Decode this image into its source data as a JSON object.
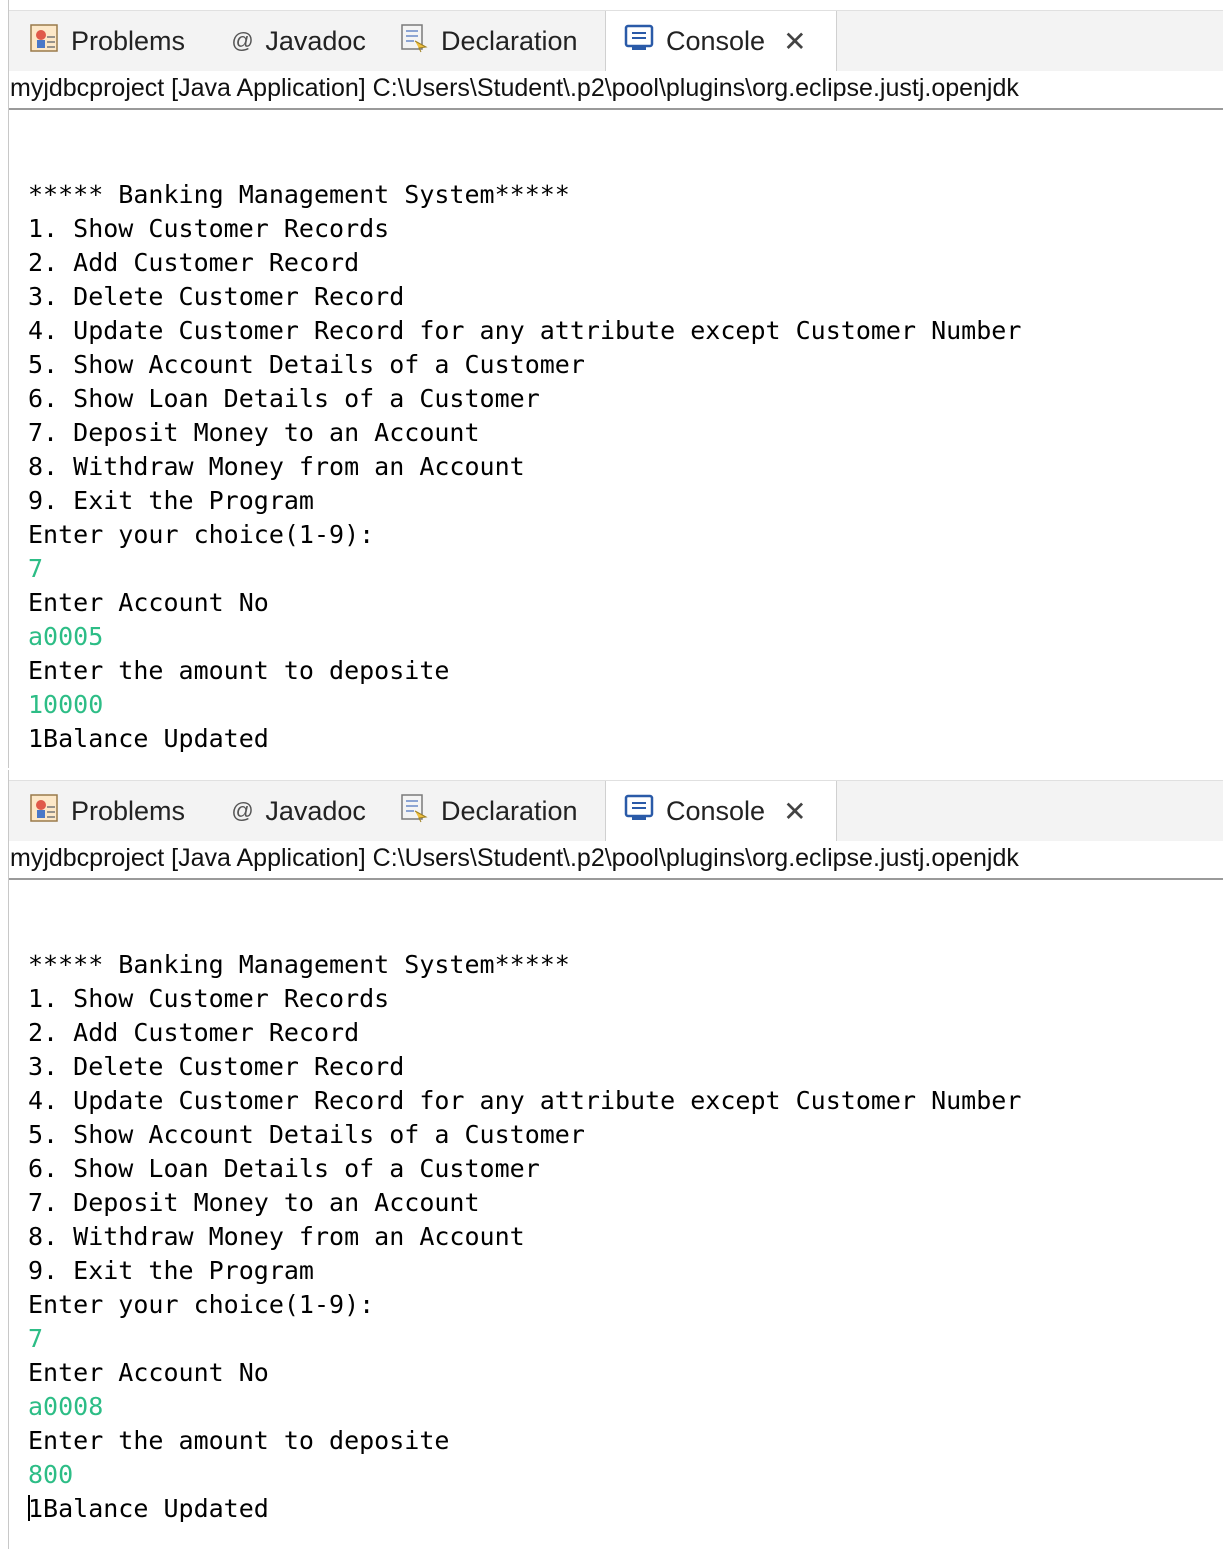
{
  "colors": {
    "input_text": "#2dbd86",
    "output_text": "#000000",
    "tabbar_bg": "#f3f3f3"
  },
  "panels": [
    {
      "tabs": [
        {
          "label": "Problems",
          "icon": "problems-icon"
        },
        {
          "label": "Javadoc",
          "icon": "at-sign-icon"
        },
        {
          "label": "Declaration",
          "icon": "declaration-icon"
        },
        {
          "label": "Console",
          "icon": "console-icon",
          "active": true
        }
      ],
      "close_glyph": "✕",
      "subtitle": "myjdbcproject [Java Application] C:\\Users\\Student\\.p2\\pool\\plugins\\org.eclipse.justj.openjdk",
      "lines": [
        {
          "text": "***** Banking Management System*****",
          "kind": "output"
        },
        {
          "text": "1. Show Customer Records",
          "kind": "output"
        },
        {
          "text": "2. Add Customer Record",
          "kind": "output"
        },
        {
          "text": "3. Delete Customer Record",
          "kind": "output"
        },
        {
          "text": "4. Update Customer Record for any attribute except Customer Number",
          "kind": "output"
        },
        {
          "text": "5. Show Account Details of a Customer",
          "kind": "output"
        },
        {
          "text": "6. Show Loan Details of a Customer",
          "kind": "output"
        },
        {
          "text": "7. Deposit Money to an Account",
          "kind": "output"
        },
        {
          "text": "8. Withdraw Money from an Account",
          "kind": "output"
        },
        {
          "text": "9. Exit the Program",
          "kind": "output"
        },
        {
          "text": "Enter your choice(1-9):",
          "kind": "output"
        },
        {
          "text": "7",
          "kind": "input"
        },
        {
          "text": "Enter Account No",
          "kind": "output"
        },
        {
          "text": "a0005",
          "kind": "input"
        },
        {
          "text": "Enter the amount to deposite",
          "kind": "output"
        },
        {
          "text": "10000",
          "kind": "input"
        },
        {
          "text": "1Balance Updated",
          "kind": "output"
        }
      ]
    },
    {
      "tabs": [
        {
          "label": "Problems",
          "icon": "problems-icon"
        },
        {
          "label": "Javadoc",
          "icon": "at-sign-icon"
        },
        {
          "label": "Declaration",
          "icon": "declaration-icon"
        },
        {
          "label": "Console",
          "icon": "console-icon",
          "active": true
        }
      ],
      "close_glyph": "✕",
      "subtitle": "myjdbcproject [Java Application] C:\\Users\\Student\\.p2\\pool\\plugins\\org.eclipse.justj.openjdk",
      "lines": [
        {
          "text": "***** Banking Management System*****",
          "kind": "output"
        },
        {
          "text": "1. Show Customer Records",
          "kind": "output"
        },
        {
          "text": "2. Add Customer Record",
          "kind": "output"
        },
        {
          "text": "3. Delete Customer Record",
          "kind": "output"
        },
        {
          "text": "4. Update Customer Record for any attribute except Customer Number",
          "kind": "output"
        },
        {
          "text": "5. Show Account Details of a Customer",
          "kind": "output"
        },
        {
          "text": "6. Show Loan Details of a Customer",
          "kind": "output"
        },
        {
          "text": "7. Deposit Money to an Account",
          "kind": "output"
        },
        {
          "text": "8. Withdraw Money from an Account",
          "kind": "output"
        },
        {
          "text": "9. Exit the Program",
          "kind": "output"
        },
        {
          "text": "Enter your choice(1-9):",
          "kind": "output"
        },
        {
          "text": "7",
          "kind": "input"
        },
        {
          "text": "Enter Account No",
          "kind": "output"
        },
        {
          "text": "a0008",
          "kind": "input"
        },
        {
          "text": "Enter the amount to deposite",
          "kind": "output"
        },
        {
          "text": "800",
          "kind": "input"
        },
        {
          "text": "1Balance Updated",
          "kind": "output",
          "caret": true
        }
      ]
    }
  ]
}
